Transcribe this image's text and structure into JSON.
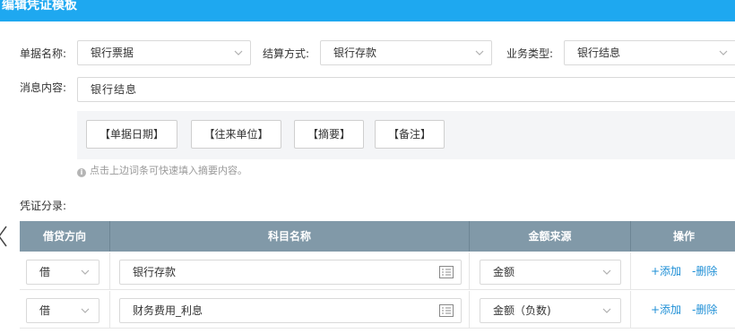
{
  "header": {
    "title": "编辑凭证模板"
  },
  "form": {
    "doc_name": {
      "label": "单据名称:",
      "value": "银行票据"
    },
    "settle_method": {
      "label": "结算方式:",
      "value": "银行存款"
    },
    "biz_type": {
      "label": "业务类型:",
      "value": "银行结息"
    },
    "message": {
      "label": "消息内容:",
      "value": "银行结息"
    },
    "tags": [
      "【单据日期】",
      "【往来单位】",
      "【摘要】",
      "【备注】"
    ],
    "hint": "点击上边词条可快速填入摘要内容。"
  },
  "entries": {
    "label": "凭证分录:",
    "columns": [
      "借贷方向",
      "科目名称",
      "金额来源",
      "操作"
    ],
    "rows": [
      {
        "direction": "借",
        "subject": "银行存款",
        "source": "金额",
        "add": "+添加",
        "del": "-删除"
      },
      {
        "direction": "借",
        "subject": "财务费用_利息",
        "source": "金额（负数)",
        "add": "+添加",
        "del": "-删除"
      }
    ]
  },
  "colors": {
    "header": "#1ea8f0",
    "table_head": "#8199a8",
    "link": "#1e8fd6"
  },
  "icons": {
    "dropdown": "chevron-down-icon",
    "picker": "list-icon",
    "info": "info-icon",
    "nav": "chevron-left-icon"
  }
}
